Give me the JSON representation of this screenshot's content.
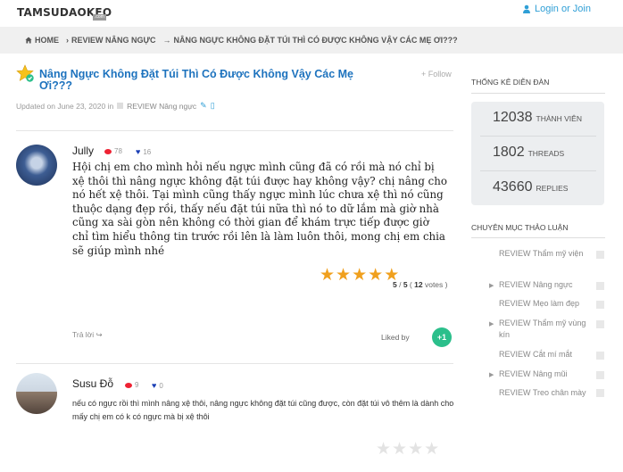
{
  "header": {
    "logo": "TAMSUDAOKEO",
    "logo_sub": ".com",
    "login_label": "Login or Join"
  },
  "breadcrumb": {
    "items": [
      "HOME",
      "REVIEW NÂNG NGỰC",
      "NÂNG NGỰC KHÔNG ĐẶT TÚI THÌ CÓ ĐƯỢC KHÔNG VẬY CÁC MẸ ƠI???"
    ]
  },
  "thread": {
    "title": "Nâng Ngực Không Đặt Túi Thì Có Được Không Vậy Các Mẹ Ơi???",
    "follow_label": "Follow",
    "updated": "Updated on June 23, 2020 in",
    "category": "REVIEW Nâng ngực"
  },
  "posts": [
    {
      "author": "Jully",
      "comments": "78",
      "likes": "16",
      "text": "Hội chị em cho mình hỏi nếu ngực mình cũng đã có rồi mà nó chỉ bị xệ thôi thì nâng ngực không đặt túi được hay không vậy? chị nâng cho nó hết xệ thôi. Tại mình cũng thấy ngực mình lúc chưa xệ thì nó cũng thuộc dạng đẹp rồi, thấy nếu đặt túi nữa thì nó to dữ lắm mà giờ nhà cũng xa sài gòn nên không có thời gian để khám trực tiếp được giờ chỉ tìm hiểu thông tin trước rồi lên là làm luôn thôi, mong chị em chia sẽ giúp mình nhé",
      "rating": "5",
      "rating_max": "5",
      "votes": "12",
      "votes_label": "votes",
      "reply_label": "Trả lời",
      "liked_by_label": "Liked by",
      "liked_badge": "+1"
    },
    {
      "author": "Susu Đỗ",
      "comments": "9",
      "likes": "0",
      "text": "nếu có ngực rồi thì mình nâng xệ thôi, nâng ngực không đặt túi cũng được, còn đặt túi vô thêm là dành cho mấy chị em có k có ngực mà bị xệ thôi"
    }
  ],
  "sidebar": {
    "stats_heading": "THỐNG KÊ DIỄN ĐÀN",
    "stats": [
      {
        "num": "12038",
        "label": "THÀNH VIÊN"
      },
      {
        "num": "1802",
        "label": "THREADS"
      },
      {
        "num": "43660",
        "label": "REPLIES"
      }
    ],
    "cats_heading": "CHUYÊN MỤC THẢO LUẬN",
    "categories": [
      {
        "label": "REVIEW Thẩm mỹ viện",
        "arrow": false
      },
      {
        "label": "REVIEW Nâng ngực",
        "arrow": true
      },
      {
        "label": "REVIEW Mẹo làm đẹp",
        "arrow": false
      },
      {
        "label": "REVIEW Thẩm mỹ vùng kín",
        "arrow": true
      },
      {
        "label": "REVIEW Cắt mí mắt",
        "arrow": false
      },
      {
        "label": "REVIEW Nâng mũi",
        "arrow": true
      },
      {
        "label": "REVIEW Treo chân mày",
        "arrow": false
      }
    ]
  },
  "colors": {
    "accent": "#2f9fd6",
    "title": "#1e73be",
    "star": "#f0a01e",
    "badge": "#2bbf8b"
  }
}
